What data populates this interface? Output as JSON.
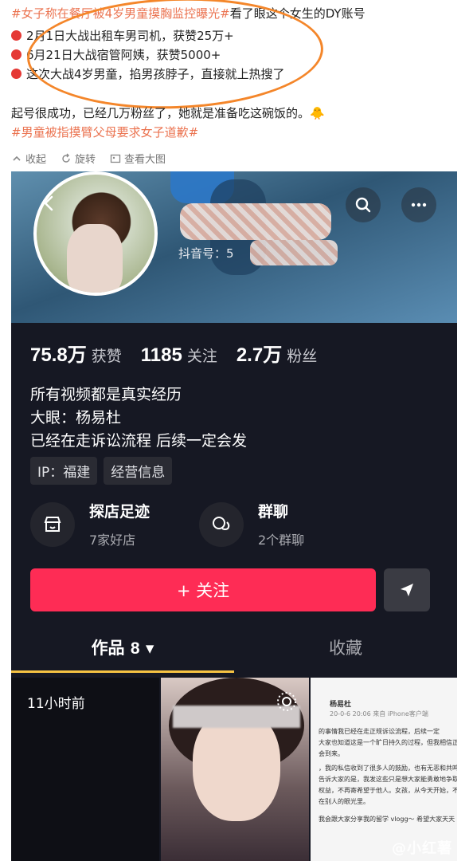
{
  "post": {
    "line1_tag1": "#女子称在餐厅被4岁男童摸胸监控曝光#",
    "line1_text": "看了眼这个女生的DY账号",
    "line2": "2月1日大战出租车男司机，获赞25万+",
    "line3": "6月21日大战宿管阿姨，获赞5000+",
    "line4": "这次大战4岁男童，掐男孩脖子，直接就上热搜了",
    "line5": "起号很成功，已经几万粉丝了，她就是准备吃这碗饭的。🐥",
    "line6_tag": "#男童被指摸臂父母要求女子道歉#",
    "actions": {
      "collect": "收起",
      "rotate": "旋转",
      "view": "查看大图"
    }
  },
  "profile": {
    "dy_label": "抖音号：",
    "dy_prefix": "5",
    "stats": [
      {
        "num": "75.8万",
        "label": "获赞"
      },
      {
        "num": "1185",
        "label": "关注"
      },
      {
        "num": "2.7万",
        "label": "粉丝"
      }
    ],
    "bio": [
      "所有视频都是真实经历",
      "大眼：杨易杜",
      "已经在走诉讼流程 后续一定会发"
    ],
    "ip_chip": "IP：福建",
    "biz_chip": "经营信息",
    "features": [
      {
        "title": "探店足迹",
        "sub": "7家好店"
      },
      {
        "title": "群聊",
        "sub": "2个群聊"
      }
    ],
    "follow_label": "+ 关注",
    "tabs": {
      "works": "作品",
      "works_count": "8",
      "fav": "收藏"
    }
  },
  "grid": {
    "time": "11小时前",
    "doc": {
      "author": "杨易杜",
      "meta": "20-0-6 20:06  来自 iPhone客户端",
      "lines": [
        "的事情我已经在走正规诉讼流程，后续一定",
        "大家也知道这是一个旷日持久的过程，但我相信正",
        "会到来。",
        "，我的私信收到了很多人的鼓励，也有无恶和共鸣",
        "告诉大家的是，我发这些只是想大家能勇敢地争取",
        "权益，不再寄希望于他人。女孩，从今天开始，不",
        "在别人的眼光里。",
        "我会跟大家分享我的留学 vlogg～ 希望大家天天"
      ]
    }
  },
  "watermark": "@小红薯"
}
